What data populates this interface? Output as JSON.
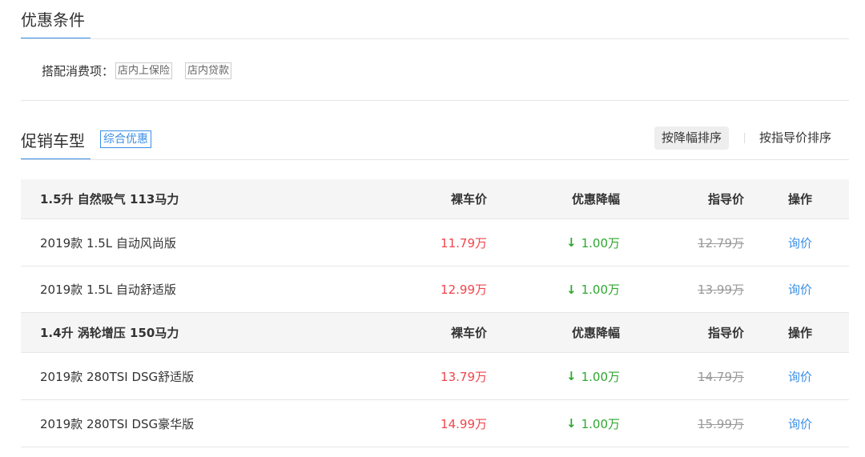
{
  "offer_conditions": {
    "title": "优惠条件",
    "options_label": "搭配消费项：",
    "options": [
      "店内上保险",
      "店内贷款"
    ]
  },
  "promo_models": {
    "title": "促销车型",
    "badge": "综合优惠",
    "sort_by_discount": "按降幅排序",
    "sort_by_msrp": "按指导价排序"
  },
  "columns": {
    "price": "裸车价",
    "discount": "优惠降幅",
    "msrp": "指导价",
    "action": "操作"
  },
  "groups": [
    {
      "header": "1.5升 自然吸气 113马力",
      "rows": [
        {
          "name": "2019款 1.5L 自动风尚版",
          "price": "11.79万",
          "discount": "1.00万",
          "msrp": "12.79万",
          "action": "询价"
        },
        {
          "name": "2019款 1.5L 自动舒适版",
          "price": "12.99万",
          "discount": "1.00万",
          "msrp": "13.99万",
          "action": "询价"
        }
      ]
    },
    {
      "header": "1.4升 涡轮增压 150马力",
      "rows": [
        {
          "name": "2019款 280TSI DSG舒适版",
          "price": "13.79万",
          "discount": "1.00万",
          "msrp": "14.79万",
          "action": "询价"
        },
        {
          "name": "2019款 280TSI DSG豪华版",
          "price": "14.99万",
          "discount": "1.00万",
          "msrp": "15.99万",
          "action": "询价"
        }
      ]
    }
  ],
  "icons": {
    "discount_arrow": "↓"
  },
  "colors": {
    "accent": "#3a8ee6",
    "price": "#f0454c",
    "discount": "#2ea72f",
    "msrp": "#999999"
  }
}
